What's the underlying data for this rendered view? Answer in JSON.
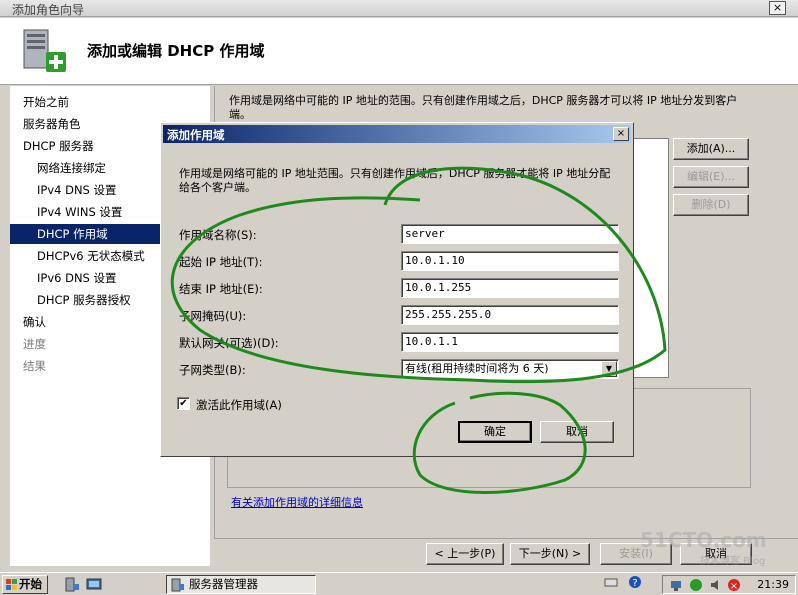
{
  "window": {
    "title": "添加角色向导",
    "close_glyph": "×"
  },
  "header": {
    "title": "添加或编辑 DHCP 作用域",
    "icon": "server-add-icon"
  },
  "nav": {
    "items": [
      {
        "label": "开始之前",
        "level": 0,
        "state": "normal"
      },
      {
        "label": "服务器角色",
        "level": 0,
        "state": "normal"
      },
      {
        "label": "DHCP 服务器",
        "level": 0,
        "state": "normal"
      },
      {
        "label": "网络连接绑定",
        "level": 1,
        "state": "normal"
      },
      {
        "label": "IPv4 DNS 设置",
        "level": 1,
        "state": "normal"
      },
      {
        "label": "IPv4 WINS 设置",
        "level": 1,
        "state": "normal"
      },
      {
        "label": "DHCP 作用域",
        "level": 1,
        "state": "active"
      },
      {
        "label": "DHCPv6 无状态模式",
        "level": 1,
        "state": "normal"
      },
      {
        "label": "IPv6 DNS 设置",
        "level": 1,
        "state": "normal"
      },
      {
        "label": "DHCP 服务器授权",
        "level": 1,
        "state": "normal"
      },
      {
        "label": "确认",
        "level": 0,
        "state": "normal"
      },
      {
        "label": "进度",
        "level": 0,
        "state": "disabled"
      },
      {
        "label": "结果",
        "level": 0,
        "state": "disabled"
      }
    ]
  },
  "main": {
    "description": "作用域是网络中可能的 IP 地址的范围。只有创建作用域之后，DHCP 服务器才可以将 IP 地址分发到客户端。",
    "add_button": "添加(A)...",
    "edit_button": "编辑(E)...",
    "delete_button": "删除(D)",
    "help_link": "有关添加作用域的详细信息"
  },
  "footer": {
    "prev_button": "< 上一步(P)",
    "next_button": "下一步(N) >",
    "install_button": "安装(I)",
    "cancel_button": "取消"
  },
  "dialog": {
    "title": "添加作用域",
    "close_glyph": "×",
    "description": "作用域是网络可能的 IP 地址范围。只有创建作用域后，DHCP 服务器才能将 IP 地址分配给各个客户端。",
    "fields": {
      "scope_name": {
        "label": "作用域名称(S):",
        "value": "server"
      },
      "start_ip": {
        "label": "起始 IP 地址(T):",
        "value": "10.0.1.10"
      },
      "end_ip": {
        "label": "结束 IP 地址(E):",
        "value": "10.0.1.255"
      },
      "subnet_mask": {
        "label": "子网掩码(U):",
        "value": "255.255.255.0"
      },
      "gateway": {
        "label": "默认网关(可选)(D):",
        "value": "10.0.1.1"
      },
      "subnet_type": {
        "label": "子网类型(B):",
        "value": "有线(租用持续时间将为 6 天)"
      }
    },
    "activate": {
      "label": "激活此作用域(A)",
      "checked": true,
      "glyph": "✔"
    },
    "ok_button": "确定",
    "cancel_button": "取消"
  },
  "taskbar": {
    "start_label": "开始",
    "task_label": "服务器管理器",
    "clock": "21:39"
  },
  "watermark": {
    "text": "51CTO.com",
    "sub": "技术博客 Blog"
  }
}
